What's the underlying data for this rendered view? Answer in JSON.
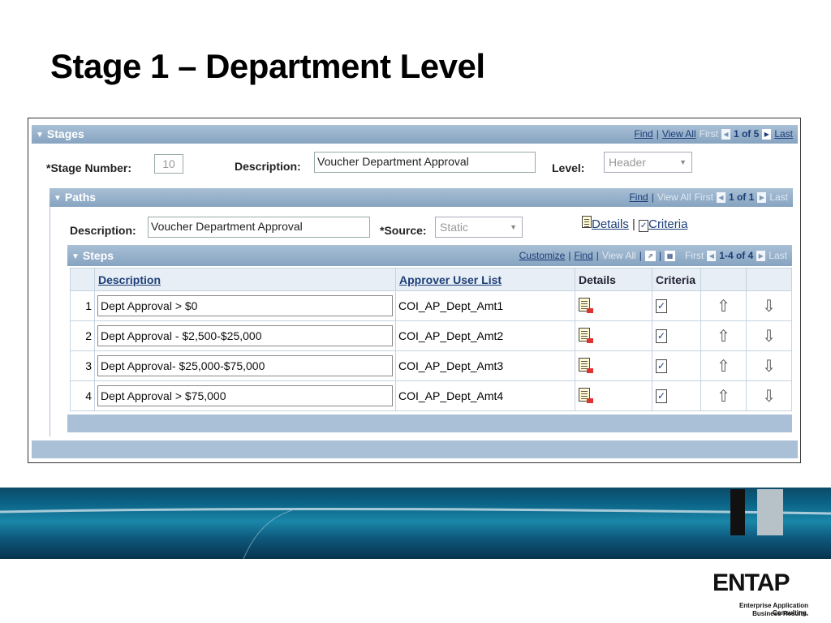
{
  "slide_title": "Stage 1 – Department Level",
  "stages": {
    "header": "Stages",
    "nav": {
      "find": "Find",
      "view_all": "View All",
      "first": "First",
      "count": "1 of 5",
      "last": "Last"
    },
    "stage_number_label": "*Stage Number:",
    "stage_number_value": "10",
    "description_label": "Description:",
    "description_value": "Voucher Department Approval",
    "level_label": "Level:",
    "level_value": "Header"
  },
  "paths": {
    "header": "Paths",
    "nav": {
      "find": "Find",
      "view_all": "View All",
      "first": "First",
      "count": "1 of 1",
      "last": "Last"
    },
    "description_label": "Description:",
    "description_value": "Voucher Department Approval",
    "source_label": "*Source:",
    "source_value": "Static",
    "details_link": "Details",
    "criteria_link": "Criteria"
  },
  "steps": {
    "header": "Steps",
    "nav": {
      "customize": "Customize",
      "find": "Find",
      "view_all": "View All",
      "first": "First",
      "count": "1-4 of 4",
      "last": "Last"
    },
    "columns": {
      "description": "Description",
      "approver": "Approver User List",
      "details": "Details",
      "criteria": "Criteria"
    },
    "rows": [
      {
        "num": "1",
        "description": "Dept Approval > $0",
        "approver": "COI_AP_Dept_Amt1"
      },
      {
        "num": "2",
        "description": "Dept Approval - $2,500-$25,000",
        "approver": "COI_AP_Dept_Amt2"
      },
      {
        "num": "3",
        "description": "Dept Approval- $25,000-$75,000",
        "approver": "COI_AP_Dept_Amt3"
      },
      {
        "num": "4",
        "description": "Dept Approval > $75,000",
        "approver": "COI_AP_Dept_Amt4"
      }
    ]
  },
  "logo": {
    "name": "ENTAP",
    "tagline1": "Enterprise Application Consulting.",
    "tagline2": "Business Results."
  }
}
